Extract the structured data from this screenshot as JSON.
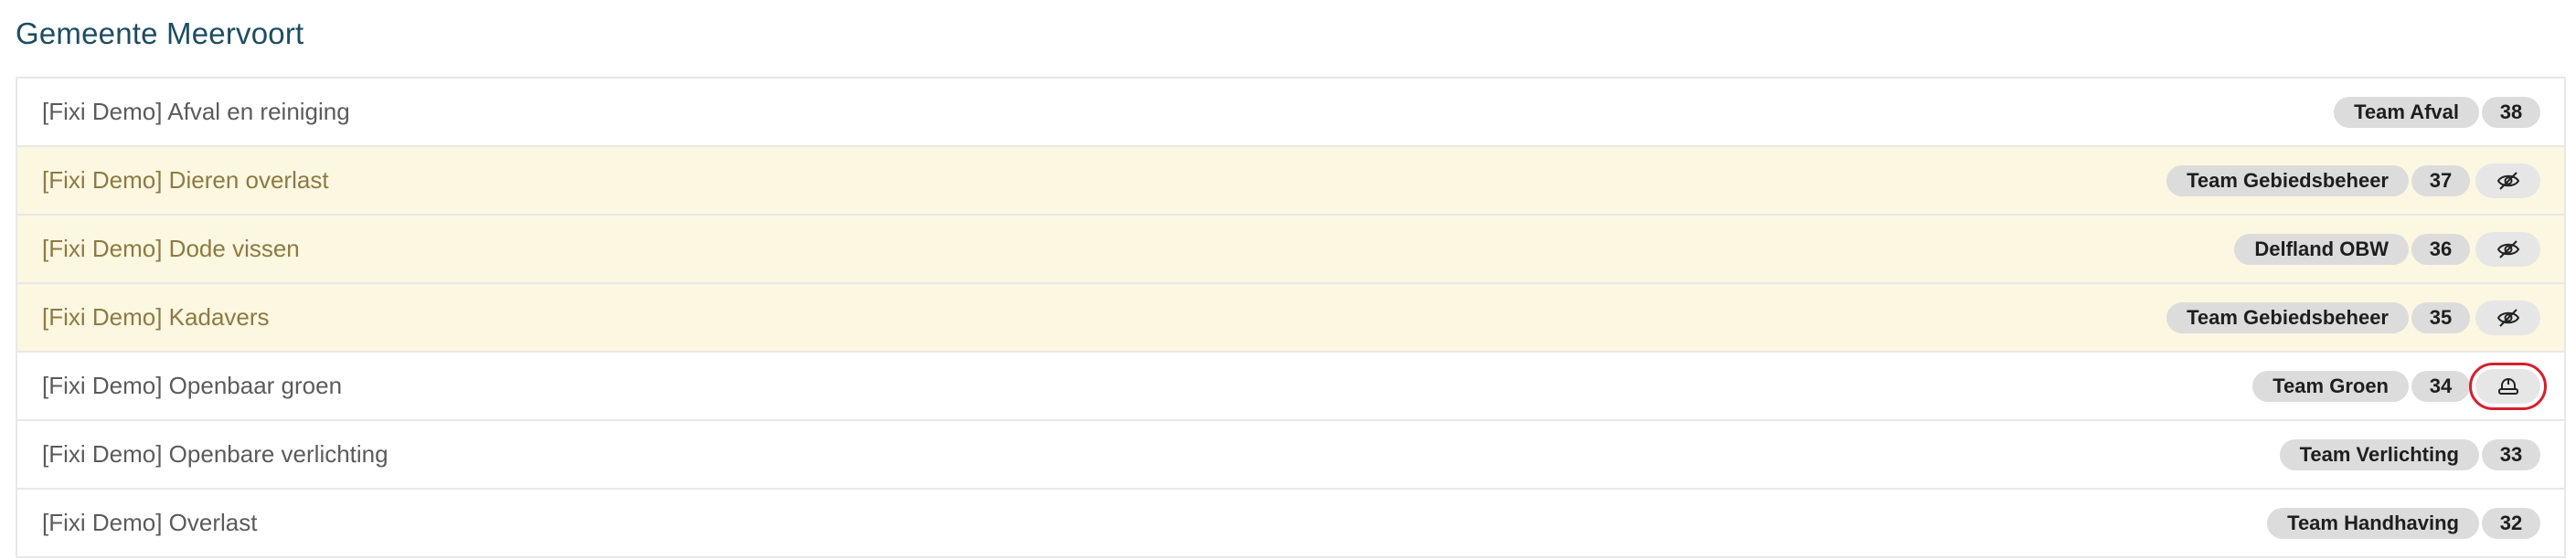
{
  "header": {
    "title": "Gemeente Meervoort"
  },
  "rows": [
    {
      "label": "[Fixi Demo] Afval en reiniging",
      "team": "Team Afval",
      "count": "38",
      "muted": false,
      "action_icon": ""
    },
    {
      "label": "[Fixi Demo] Dieren overlast",
      "team": "Team Gebiedsbeheer",
      "count": "37",
      "muted": true,
      "action_icon": "eye-off-icon"
    },
    {
      "label": "[Fixi Demo] Dode vissen",
      "team": "Delfland OBW",
      "count": "36",
      "muted": true,
      "action_icon": "eye-off-icon"
    },
    {
      "label": "[Fixi Demo] Kadavers",
      "team": "Team Gebiedsbeheer",
      "count": "35",
      "muted": true,
      "action_icon": "eye-off-icon"
    },
    {
      "label": "[Fixi Demo] Openbaar groen",
      "team": "Team Groen",
      "count": "34",
      "muted": false,
      "action_icon": "hard-hat-icon",
      "selected": true
    },
    {
      "label": "[Fixi Demo] Openbare verlichting",
      "team": "Team Verlichting",
      "count": "33",
      "muted": false,
      "action_icon": ""
    },
    {
      "label": "[Fixi Demo] Overlast",
      "team": "Team Handhaving",
      "count": "32",
      "muted": false,
      "action_icon": ""
    }
  ],
  "colors": {
    "title": "#1d4d63",
    "muted_row_bg": "#fcf7e1",
    "muted_row_text": "#8d7a43",
    "pill_bg": "#dcdcdc",
    "selection_outline": "#d81e2c"
  }
}
